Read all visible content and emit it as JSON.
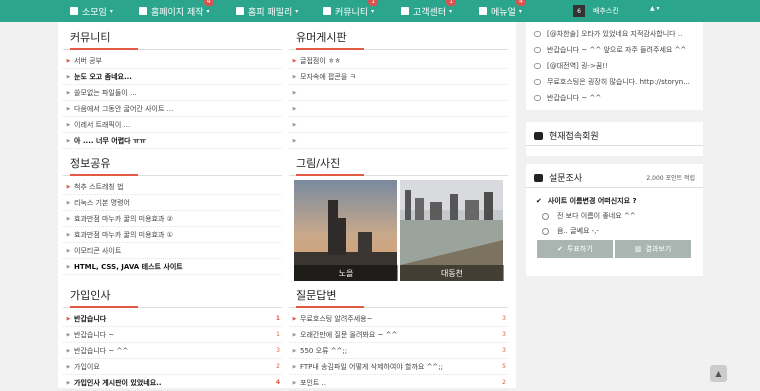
{
  "nav": {
    "items": [
      {
        "label": "소모임",
        "icon": "bell-icon",
        "badge": ""
      },
      {
        "label": "홈페이지 제작",
        "icon": "monitor-icon",
        "badge": "4"
      },
      {
        "label": "홈피 패밀리",
        "icon": "cart-icon",
        "badge": ""
      },
      {
        "label": "커뮤니티",
        "icon": "cart-icon",
        "badge": "1"
      },
      {
        "label": "고객센터",
        "icon": "desktop-icon",
        "badge": "1"
      },
      {
        "label": "메뉴얼",
        "icon": "users-icon",
        "badge": "4"
      }
    ],
    "user": {
      "avatar": "6",
      "name": "배추스킨"
    }
  },
  "community": {
    "title": "커뮤니티",
    "items": [
      "서버 공부",
      "눈도 오고 좀네요...",
      "쓸모없는 파일들이 ...",
      "다음에서 그동안 굶어간 사이트 ...",
      "이레서 트래픽이 ...",
      "아 .... 너무 어렵다 ㅠㅠ"
    ]
  },
  "humor": {
    "title": "유머게시판",
    "items": [
      "글접점이 ㅎㅎ",
      "모자속에 팝콘을 ㅋ",
      "",
      "",
      "",
      ""
    ]
  },
  "info": {
    "title": "정보공유",
    "items": [
      "척추 스트레칭 법",
      "리눅스 기본 명령어",
      "효과만점 마누카 꿀의 미용효과 ②",
      "효과만점 마누카 꿀의 미용효과 ①",
      "이모티콘 사이트",
      "HTML, CSS, JAVA 테스트 사이트"
    ]
  },
  "photo": {
    "title": "그림/사진",
    "items": [
      {
        "caption": "노을"
      },
      {
        "caption": "대동천"
      }
    ]
  },
  "greet": {
    "title": "가입인사",
    "items": [
      {
        "text": "반갑습니다",
        "count": "1"
      },
      {
        "text": "반갑습니다 ~",
        "count": "1"
      },
      {
        "text": "반갑습니다 ~ ^^",
        "count": "3"
      },
      {
        "text": "가입이요",
        "count": "2"
      },
      {
        "text": "가입인사 게시판이 있었네요..",
        "count": "4"
      }
    ]
  },
  "qna": {
    "title": "질문답변",
    "items": [
      {
        "text": "무료호스팅 알려주세용~",
        "count": "3"
      },
      {
        "text": "오래간만에 질문 올려봐요 ~ ^^",
        "count": "3"
      },
      {
        "text": "550 오류 ^^;;",
        "count": "3"
      },
      {
        "text": "FTP내 송김파일 어떻게 삭제하여야 할까요 ^^;;",
        "count": "5"
      },
      {
        "text": "포인트 ..",
        "count": "2"
      }
    ]
  },
  "comments": [
    "[@차한솔] 오타가 있었네요 지적감사합니다 ..",
    "반갑습니다 ~ ^^ 앞으로 자주 들려주세요 ^^",
    "[@대전역] 굉->꿈!!",
    "무료호스팅은 굉장히 많습니다. http://storyn...",
    "반갑습니다 ~ ^^"
  ],
  "members": {
    "title": "현재접속회원"
  },
  "poll": {
    "title": "설문조사",
    "points": "2,000 포인트 적립",
    "question": "사이트 이름변경 어떠신지요 ?",
    "options": [
      "전 보다 이름이 좋네요 ^^",
      "음.. 글쎄요 -,-"
    ],
    "vote_label": "투표하기",
    "result_label": "결과보기"
  },
  "colors": {
    "nav": "#2ca58d",
    "accent": "#e05a44"
  }
}
